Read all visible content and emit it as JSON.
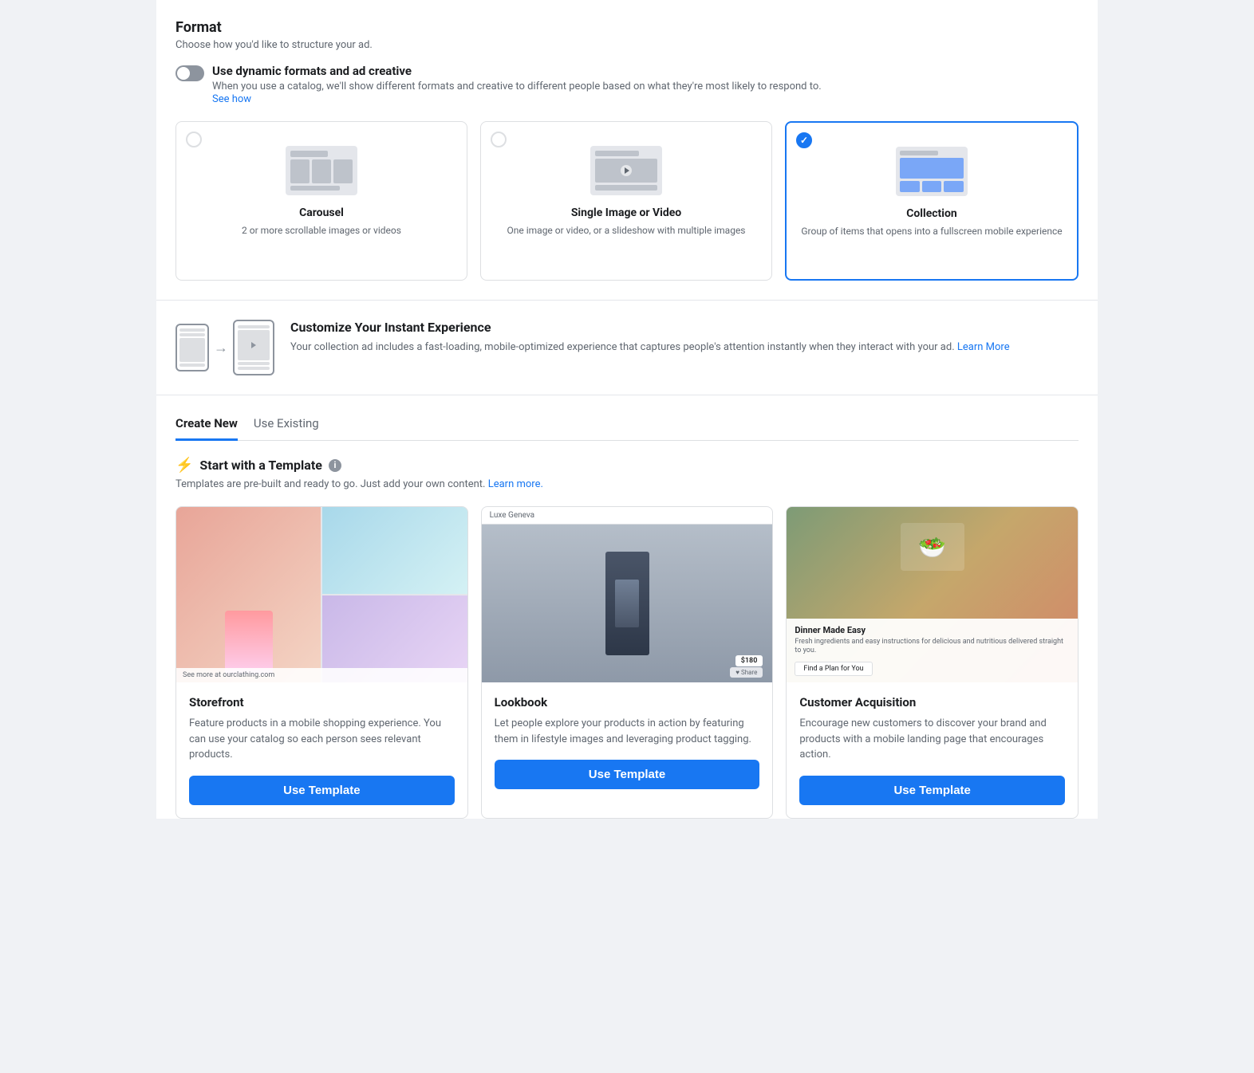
{
  "format": {
    "title": "Format",
    "subtitle": "Choose how you'd like to structure your ad.",
    "toggle": {
      "label": "Use dynamic formats and ad creative",
      "description": "When you use a catalog, we'll show different formats and creative to different people based on what they're most likely to respond to.",
      "see_how": "See how"
    },
    "cards": [
      {
        "id": "carousel",
        "title": "Carousel",
        "description": "2 or more scrollable images or videos",
        "selected": false
      },
      {
        "id": "single",
        "title": "Single Image or Video",
        "description": "One image or video, or a slideshow with multiple images",
        "selected": false
      },
      {
        "id": "collection",
        "title": "Collection",
        "description": "Group of items that opens into a fullscreen mobile experience",
        "selected": true
      }
    ]
  },
  "instant_experience": {
    "title": "Customize Your Instant Experience",
    "description": "Your collection ad includes a fast-loading, mobile-optimized experience that captures people's attention instantly when they interact with your ad.",
    "learn_more": "Learn More"
  },
  "tabs": {
    "create_new": "Create New",
    "use_existing": "Use Existing",
    "active": "create_new"
  },
  "templates": {
    "heading": "Start with a Template",
    "subtext": "Templates are pre-built and ready to go. Just add your own content.",
    "learn_more": "Learn more.",
    "items": [
      {
        "id": "storefront",
        "title": "Storefront",
        "description": "Feature products in a mobile shopping experience. You can use your catalog so each person sees relevant products.",
        "button_label": "Use Template"
      },
      {
        "id": "lookbook",
        "title": "Lookbook",
        "description": "Let people explore your products in action by featuring them in lifestyle images and leveraging product tagging.",
        "button_label": "Use Template"
      },
      {
        "id": "customer_acquisition",
        "title": "Customer Acquisition",
        "description": "Encourage new customers to discover your brand and products with a mobile landing page that encourages action.",
        "button_label": "Use Template"
      }
    ]
  }
}
